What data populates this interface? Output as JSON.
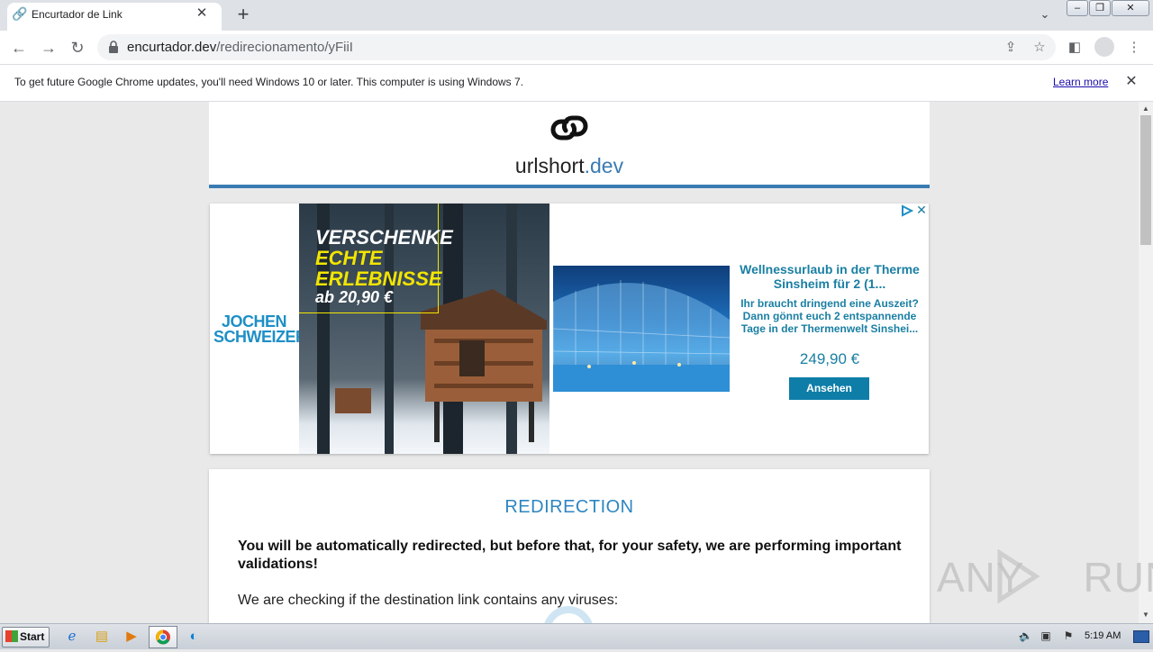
{
  "browser": {
    "tab_title": "Encurtador de Link",
    "url_host": "encurtador.dev",
    "url_path": "/redirecionamento/yFiiI",
    "infobar_text": "To get future Google Chrome updates, you'll need Windows 10 or later. This computer is using Windows 7.",
    "infobar_link": "Learn more"
  },
  "site": {
    "logo_main": "urlshort",
    "logo_accent": ".dev",
    "accent_color": "#3b7bb3"
  },
  "ad": {
    "brand": "JOCHEN SCHWEIZER",
    "headline_1": "VERSCHENKE",
    "headline_2": "ECHTE",
    "headline_3": "ERLEBNISSE",
    "price_tag": "ab 20,90 €",
    "product_title": "Wellnessurlaub in der Therme Sinsheim für 2 (1...",
    "product_desc": "Ihr braucht dringend eine Auszeit? Dann gönnt euch 2 entspannende Tage in der Thermenwelt Sinshei...",
    "product_price": "249,90 €",
    "cta": "Ansehen"
  },
  "main": {
    "title": "REDIRECTION",
    "warning": "You will be automatically redirected, but before that, for your safety, we are performing important validations!",
    "checking": "We are checking if the destination link contains any viruses:"
  },
  "watermark": {
    "text": "ANY RUN"
  },
  "taskbar": {
    "start_label": "Start",
    "clock": "5:19 AM"
  }
}
